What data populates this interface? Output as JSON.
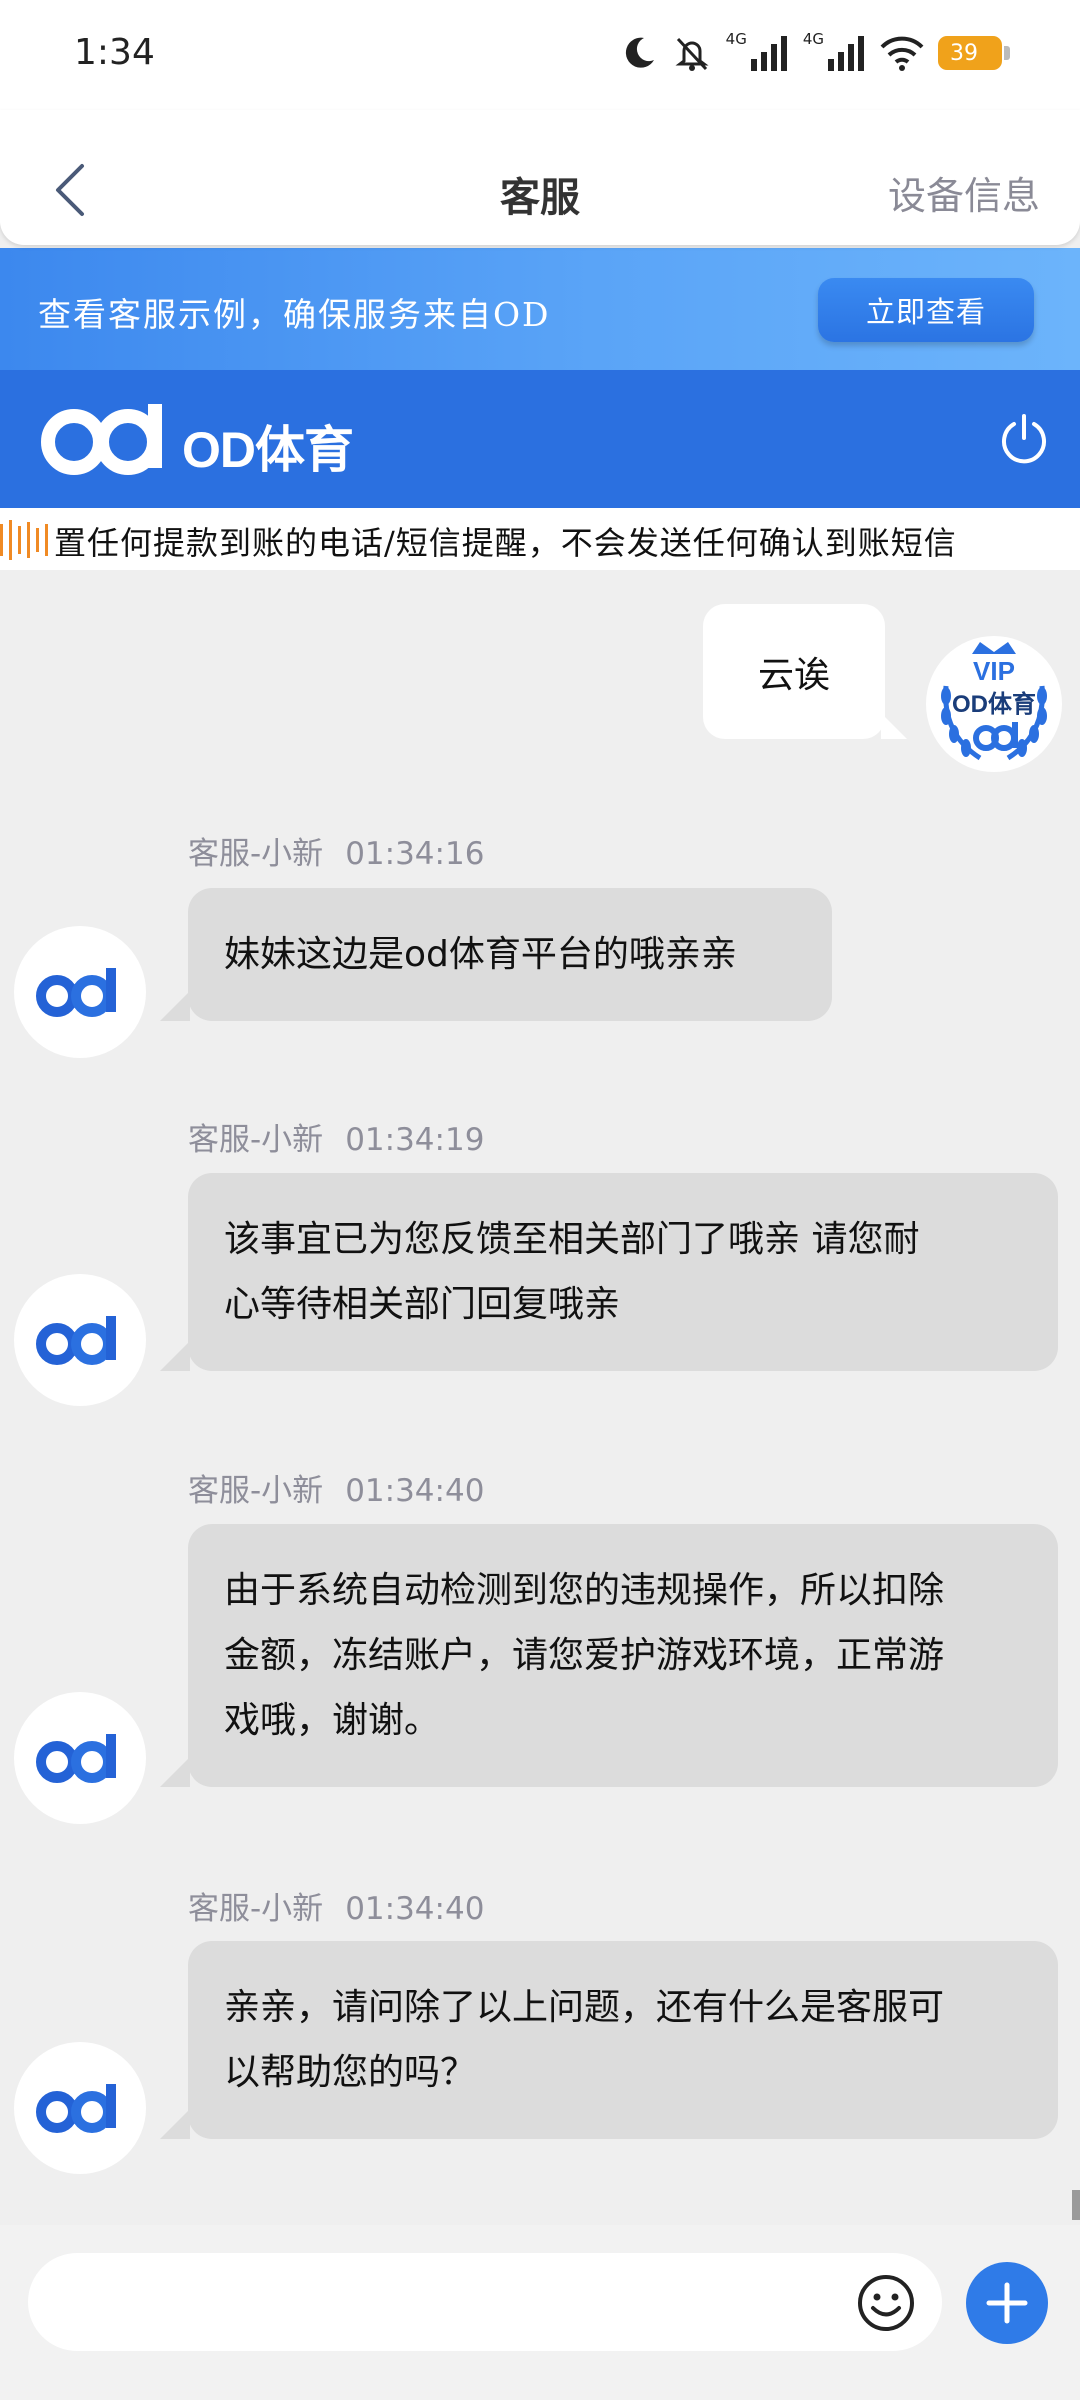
{
  "status_bar": {
    "time": "1:34",
    "network_left": "4G",
    "network_right": "4G",
    "wifi_sub": "6",
    "battery": "39"
  },
  "header": {
    "title": "客服",
    "device_info": "设备信息"
  },
  "notice_banner": {
    "text": "查看客服示例，确保服务来自OD",
    "button": "立即查看"
  },
  "brand": {
    "name": "OD体育"
  },
  "marquee": {
    "text": "置任何提款到账的电话/短信提醒，不会发送任何确认到账短信"
  },
  "chat": {
    "user_message": {
      "text": "云诶",
      "avatar": {
        "vip": "VIP",
        "brand": "OD体育"
      }
    },
    "agent_messages": [
      {
        "name": "客服-小新",
        "time": "01:34:16",
        "lines": [
          "妹妹这边是od体育平台的哦亲亲"
        ]
      },
      {
        "name": "客服-小新",
        "time": "01:34:19",
        "lines": [
          "该事宜已为您反馈至相关部门了哦亲  请您耐",
          "心等待相关部门回复哦亲"
        ]
      },
      {
        "name": "客服-小新",
        "time": "01:34:40",
        "lines": [
          "由于系统自动检测到您的违规操作，所以扣除",
          "金额，冻结账户，请您爱护游戏环境，正常游",
          "戏哦，谢谢。"
        ]
      },
      {
        "name": "客服-小新",
        "time": "01:34:40",
        "lines": [
          "亲亲，请问除了以上问题，还有什么是客服可",
          "以帮助您的吗？"
        ]
      }
    ]
  },
  "input": {
    "placeholder": ""
  },
  "colors": {
    "brand_blue": "#2b70e0",
    "banner_blue": "#4a96f3",
    "bubble_gray": "#dcdcdc",
    "battery_orange": "#f0a21b"
  }
}
